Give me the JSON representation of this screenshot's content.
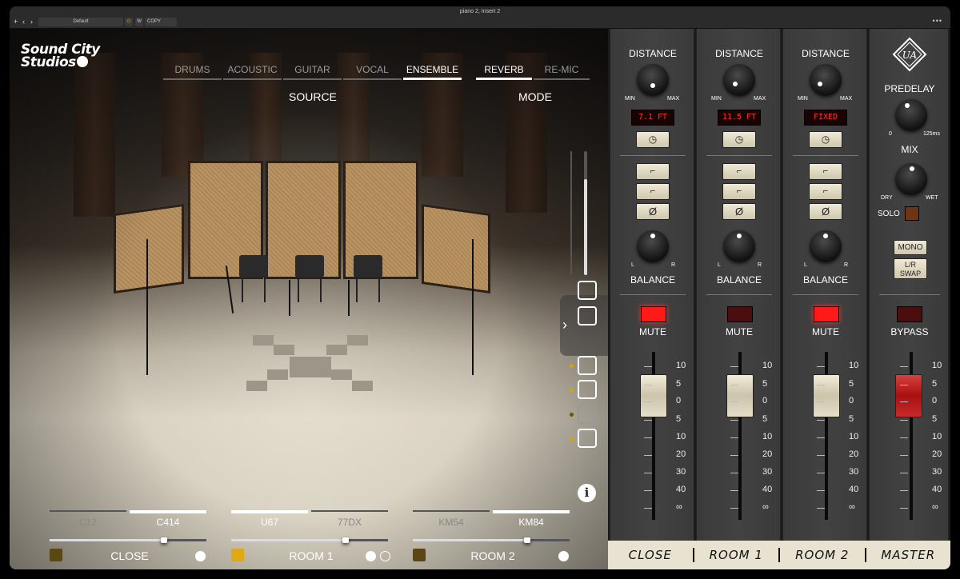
{
  "window": {
    "title": "piano 2, Insert 2",
    "preset": "Default",
    "copy_label": "COPY",
    "w_label": "W"
  },
  "logo": {
    "line1": "Sound City",
    "line2": "Studios"
  },
  "source": {
    "caption": "SOURCE",
    "tabs": [
      "DRUMS",
      "ACOUSTIC",
      "GUITAR",
      "VOCAL",
      "ENSEMBLE"
    ],
    "active": "ENSEMBLE"
  },
  "mode": {
    "caption": "MODE",
    "tabs": [
      "REVERB",
      "RE-MIC"
    ],
    "active": "REVERB"
  },
  "mics": [
    {
      "options": [
        "C12",
        "C414"
      ],
      "active": "C414",
      "level": 0.73,
      "name": "CLOSE",
      "square_color": "#5a4712",
      "icon": "stereo-icon"
    },
    {
      "options": [
        "U67",
        "77DX"
      ],
      "active": "U67",
      "level": 0.73,
      "name": "ROOM 1",
      "square_color": "#e0a812",
      "icon": "stereo-pair-icon"
    },
    {
      "options": [
        "KM54",
        "KM84"
      ],
      "active": "KM84",
      "level": 0.73,
      "name": "ROOM 2",
      "square_color": "#5a4712",
      "icon": "stereo-icon"
    }
  ],
  "strips": [
    {
      "distance_label": "DISTANCE",
      "min": "MIN",
      "max": "MAX",
      "readout": "7.1 FT",
      "balance_label": "BALANCE",
      "bal_l": "L",
      "bal_r": "R",
      "mute_label": "MUTE",
      "mute_on": true,
      "fader_db": 0
    },
    {
      "distance_label": "DISTANCE",
      "min": "MIN",
      "max": "MAX",
      "readout": "11.5 FT",
      "balance_label": "BALANCE",
      "bal_l": "L",
      "bal_r": "R",
      "mute_label": "MUTE",
      "mute_on": false,
      "fader_db": 0
    },
    {
      "distance_label": "DISTANCE",
      "min": "MIN",
      "max": "MAX",
      "readout": "FIXED",
      "balance_label": "BALANCE",
      "bal_l": "L",
      "bal_r": "R",
      "mute_label": "MUTE",
      "mute_on": true,
      "fader_db": 0
    }
  ],
  "master": {
    "predelay_label": "PREDELAY",
    "predelay_min": "0",
    "predelay_max": "125ms",
    "mix_label": "MIX",
    "mix_dry": "DRY",
    "mix_wet": "WET",
    "solo_label": "SOLO",
    "mono_label": "MONO",
    "swap_label": "L/R\nSWAP",
    "bypass_label": "BYPASS",
    "fader_db": 0
  },
  "fader_scale": [
    "10",
    "5",
    "0",
    "5",
    "10",
    "20",
    "30",
    "40",
    "∞"
  ],
  "footer": [
    "CLOSE",
    "ROOM 1",
    "ROOM 2",
    "MASTER"
  ],
  "colors": {
    "mute_on": "#ff1a1a",
    "mute_off": "#4a0e0e",
    "led_text": "#ff3030",
    "master_fader": "#c8201e",
    "accent_yellow": "#d8a400"
  }
}
